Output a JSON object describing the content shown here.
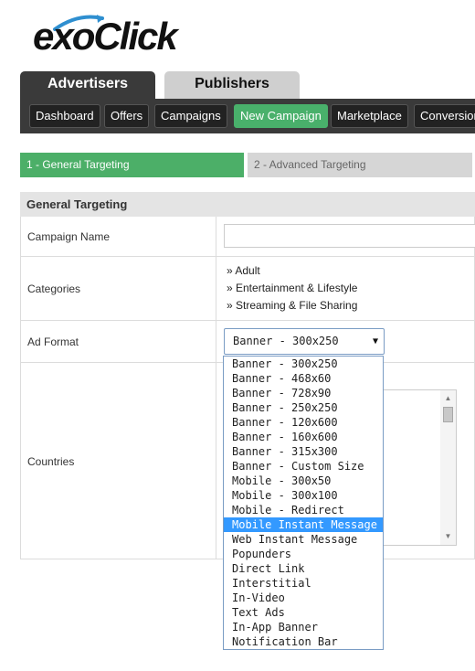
{
  "logo": {
    "text": "exoClick"
  },
  "primary_tabs": [
    {
      "label": "Advertisers",
      "active": true
    },
    {
      "label": "Publishers",
      "active": false
    }
  ],
  "subnav": [
    {
      "label": "Dashboard",
      "active": false
    },
    {
      "label": "Offers",
      "active": false
    },
    {
      "label": "Campaigns",
      "active": false
    },
    {
      "label": "New Campaign",
      "active": true
    },
    {
      "label": "Marketplace",
      "active": false
    },
    {
      "label": "Conversion",
      "active": false
    }
  ],
  "steps": [
    {
      "label": "1 - General Targeting",
      "active": true
    },
    {
      "label": "2 - Advanced Targeting",
      "active": false
    }
  ],
  "section": {
    "title": "General Targeting"
  },
  "form": {
    "campaign_name": {
      "label": "Campaign Name",
      "value": ""
    },
    "categories": {
      "label": "Categories",
      "items": [
        "» Adult",
        "» Entertainment & Lifestyle",
        "» Streaming & File Sharing"
      ]
    },
    "ad_format": {
      "label": "Ad Format",
      "selected": "Banner - 300x250",
      "arrow": "▼",
      "highlighted_index": 11,
      "options": [
        "Banner - 300x250",
        "Banner - 468x60",
        "Banner - 728x90",
        "Banner - 250x250",
        "Banner - 120x600",
        "Banner - 160x600",
        "Banner - 315x300",
        "Banner - Custom Size",
        "Mobile - 300x50",
        "Mobile - 300x100",
        "Mobile - Redirect",
        "Mobile Instant Message",
        "Web Instant Message",
        "Popunders",
        "Direct Link",
        "Interstitial",
        "In-Video",
        "Text Ads",
        "In-App Banner",
        "Notification Bar"
      ]
    },
    "countries": {
      "label": "Countries"
    }
  },
  "scrollbar": {
    "up": "▲",
    "down": "▼"
  },
  "colors": {
    "accent_green": "#4caf68",
    "dark_nav": "#3a3a3a",
    "highlight_blue": "#3399ff"
  }
}
